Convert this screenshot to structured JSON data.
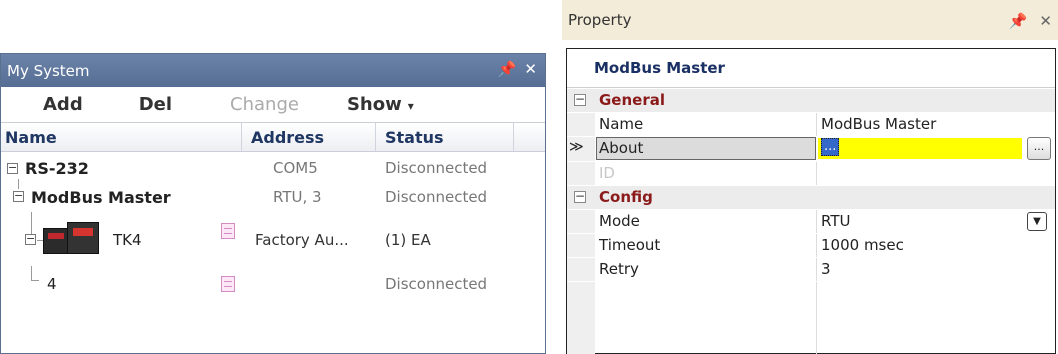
{
  "my_system": {
    "title": "My System",
    "title_buttons": {
      "pin": "I",
      "close": "✕"
    },
    "toolbar": {
      "add": "Add",
      "del": "Del",
      "change": "Change",
      "show": "Show",
      "show_caret": "▾"
    },
    "columns": {
      "name": "Name",
      "address": "Address",
      "status": "Status"
    },
    "rows": [
      {
        "name": "RS-232",
        "address": "COM5",
        "status": "Disconnected"
      },
      {
        "name": "ModBus Master",
        "address": "RTU, 3",
        "status": "Disconnected"
      },
      {
        "name": "TK4",
        "address": "Factory Au...",
        "status": "(1) EA"
      },
      {
        "name": "4",
        "address": "",
        "status": "Disconnected"
      }
    ]
  },
  "property": {
    "title": "Property",
    "title_buttons": {
      "pin": "I",
      "close": "✕"
    },
    "object_name": "ModBus Master",
    "categories": {
      "general": "General",
      "config": "Config"
    },
    "general_rows": [
      {
        "key": "Name",
        "value": "ModBus Master"
      },
      {
        "key": "About",
        "value": "..."
      },
      {
        "key": "ID",
        "value": ""
      }
    ],
    "config_rows": [
      {
        "key": "Mode",
        "value": "RTU"
      },
      {
        "key": "Timeout",
        "value": "1000 msec"
      },
      {
        "key": "Retry",
        "value": "3"
      }
    ],
    "selected_marker": "≫",
    "ellipsis_button": "...",
    "dropdown_arrow": "▼",
    "expander_minus": "−"
  }
}
